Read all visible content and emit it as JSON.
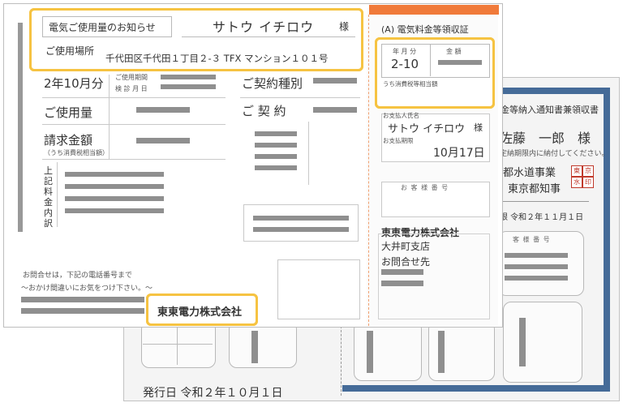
{
  "front": {
    "notice_title": "電気ご使用量のお知らせ",
    "customer_name": "サトウ イチロウ",
    "honorific": "様",
    "location_label": "ご使用場所",
    "location_value": "千代田区千代田１丁目２-３ TFX マンション１０１号",
    "period": "2年10月分",
    "reading_label_1": "ご使用期間",
    "reading_label_2": "検 診 月 日",
    "usage_label": "ご使用量",
    "billing_label": "請求金額",
    "tax_note": "（うち消費税相当額）",
    "itemized_label": "上記料金内訳",
    "contract_type_label": "ご契約種別",
    "contract_label": "ご 契 約",
    "contact_line_1": "お問合せは，下記の電話番号まで",
    "contact_line_2": "～おかけ間違いにお気をつけ下さい。～",
    "company": "東東電力株式会社"
  },
  "receipt": {
    "title": "(A) 電気料金等領収証",
    "date_header": "年 月 分",
    "date_value": "2-10",
    "amount_header": "金 額",
    "tax_label": "うち消費税等相当額",
    "payer_label": "お支払人氏名",
    "payer_name": "サトウ イチロウ",
    "payer_honorific": "様",
    "due_label": "お支払期限",
    "due_value": "10月17日",
    "customer_number_label": "お 客 様 番 号",
    "company": "東東電力株式会社",
    "branch": "大井町支店",
    "contact": "お問合せ先"
  },
  "back": {
    "title": "金等納入通知書兼領収書",
    "recipient": "佐藤　一郎　様",
    "note": "定納期限内に納付してください。",
    "issuer_1": "都水道事業",
    "issuer_2": "東京都知事",
    "date": "限 令和２年１１月１日",
    "customer_number_label": "客 様 番 号",
    "issue_date": "発行日 令和２年１０月１日"
  }
}
